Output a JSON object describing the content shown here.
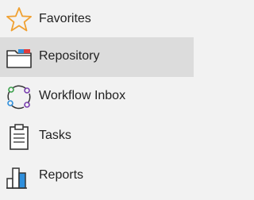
{
  "sidebar": {
    "items": [
      {
        "label": "Favorites",
        "icon": "star-icon",
        "active": false
      },
      {
        "label": "Repository",
        "icon": "folder-icon",
        "active": true
      },
      {
        "label": "Workflow Inbox",
        "icon": "workflow-cycle-icon",
        "active": false
      },
      {
        "label": "Tasks",
        "icon": "clipboard-icon",
        "active": false
      },
      {
        "label": "Reports",
        "icon": "bar-chart-icon",
        "active": false
      }
    ]
  },
  "colors": {
    "background": "#f2f2f2",
    "active_background": "#dcdcdc",
    "star": "#f0a030",
    "accent_blue": "#2f8fdc",
    "accent_red": "#e03c3c",
    "accent_purple": "#7a3fb0",
    "accent_green": "#3aa04a"
  }
}
